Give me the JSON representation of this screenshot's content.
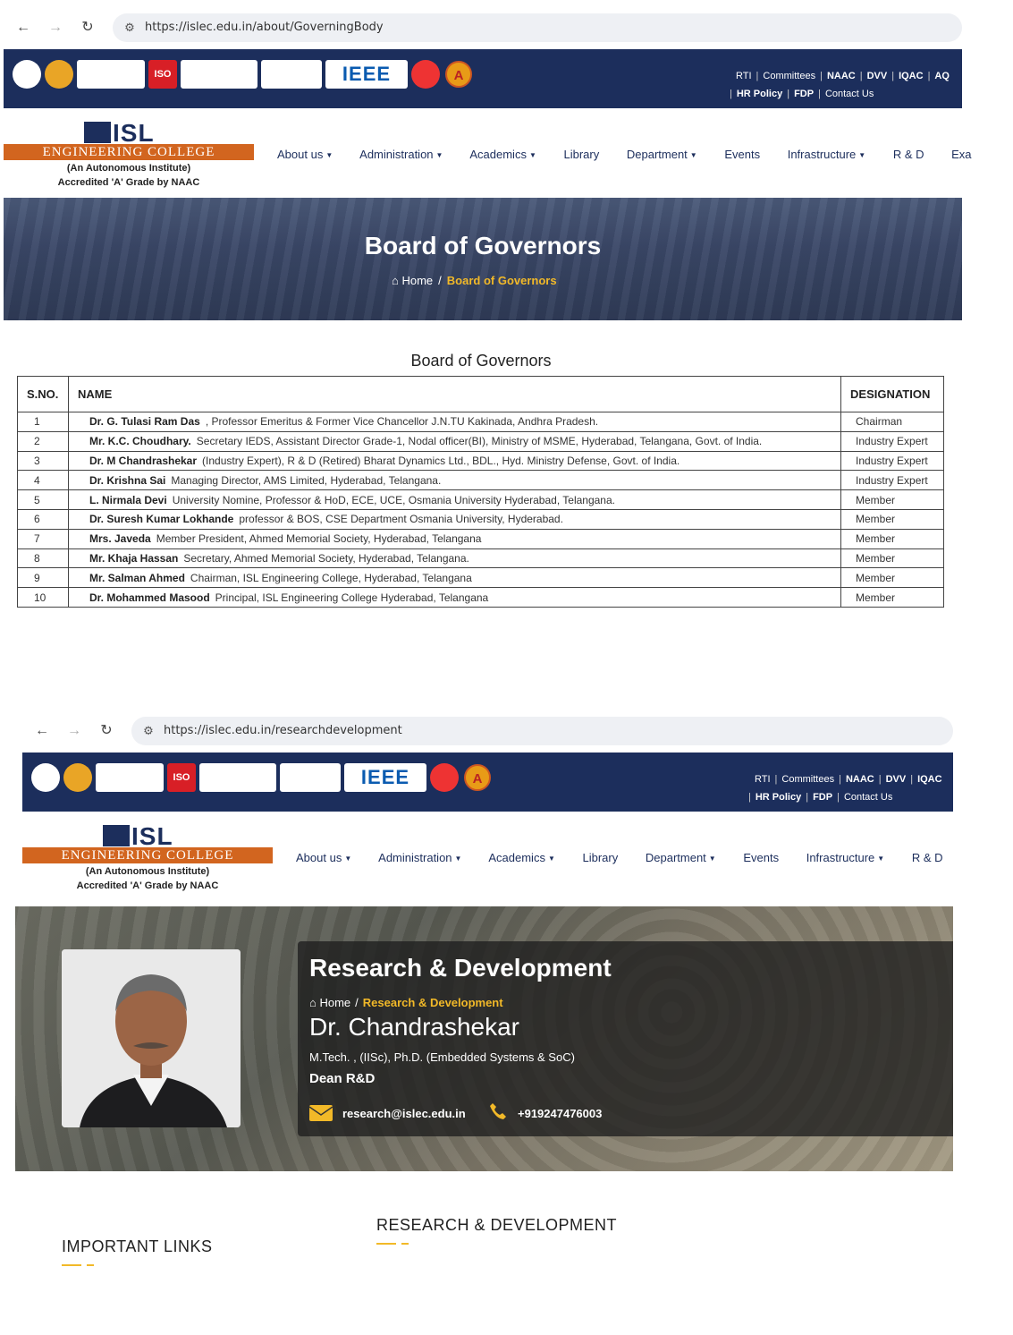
{
  "shot1": {
    "url": "https://islec.edu.in/about/GoverningBody",
    "breadcrumb": {
      "home": "Home",
      "current": "Board of Governors"
    },
    "banner_title": "Board of Governors",
    "table_title": "Board of Governors",
    "columns": {
      "sno": "S.NO.",
      "name": "NAME",
      "designation": "DESIGNATION"
    },
    "rows": [
      {
        "sno": "1",
        "name": "Dr. G. Tulasi Ram Das",
        "detail": ", Professor Emeritus & Former Vice Chancellor J.N.TU Kakinada, Andhra Pradesh.",
        "designation": "Chairman"
      },
      {
        "sno": "2",
        "name": "Mr. K.C. Choudhary.",
        "detail": "Secretary IEDS, Assistant Director Grade-1, Nodal officer(BI), Ministry of MSME, Hyderabad, Telangana, Govt. of India.",
        "designation": "Industry Expert"
      },
      {
        "sno": "3",
        "name": "Dr. M Chandrashekar",
        "detail": "(Industry Expert), R & D (Retired) Bharat Dynamics Ltd., BDL., Hyd. Ministry Defense, Govt. of India.",
        "designation": "Industry Expert"
      },
      {
        "sno": "4",
        "name": "Dr. Krishna Sai",
        "detail": "Managing Director, AMS Limited, Hyderabad, Telangana.",
        "designation": "Industry Expert"
      },
      {
        "sno": "5",
        "name": "L. Nirmala Devi",
        "detail": "University Nomine, Professor & HoD, ECE, UCE, Osmania University Hyderabad, Telangana.",
        "designation": "Member"
      },
      {
        "sno": "6",
        "name": "Dr. Suresh Kumar Lokhande",
        "detail": "professor & BOS, CSE Department Osmania University, Hyderabad.",
        "designation": "Member"
      },
      {
        "sno": "7",
        "name": "Mrs. Javeda",
        "detail": "Member President, Ahmed Memorial Society, Hyderabad, Telangana",
        "designation": "Member"
      },
      {
        "sno": "8",
        "name": "Mr. Khaja Hassan",
        "detail": "Secretary, Ahmed Memorial Society, Hyderabad, Telangana.",
        "designation": "Member"
      },
      {
        "sno": "9",
        "name": "Mr. Salman Ahmed",
        "detail": "Chairman, ISL Engineering College, Hyderabad, Telangana",
        "designation": "Member"
      },
      {
        "sno": "10",
        "name": "Dr. Mohammed Masood",
        "detail": "Principal, ISL Engineering College Hyderabad, Telangana",
        "designation": "Member"
      }
    ]
  },
  "shot2": {
    "url": "https://islec.edu.in/researchdevelopment",
    "banner_title": "Research & Development",
    "breadcrumb": {
      "home": "Home",
      "current": "Research & Development"
    },
    "person_name": "Dr. Chandrashekar",
    "qualification": "M.Tech. , (IISc), Ph.D. (Embedded Systems & SoC)",
    "role": "Dean R&D",
    "email": "research@islec.edu.in",
    "phone": "+919247476003",
    "important_links": "IMPORTANT LINKS",
    "rd_heading": "RESEARCH & DEVELOPMENT"
  },
  "site": {
    "college_short": "ISL",
    "college_band": "ENGINEERING COLLEGE",
    "college_sub1": "(An Autonomous Institute)",
    "college_sub2": "Accredited 'A' Grade by NAAC",
    "logos": [
      "IEEE",
      "ISO"
    ],
    "naac_logo": "A",
    "toplinks": [
      "RTI",
      "Committees",
      "NAAC",
      "DVV",
      "IQAC",
      "AQ"
    ],
    "toplinks_b": [
      "RTI",
      "Committees",
      "NAAC",
      "DVV",
      "IQAC"
    ],
    "toplinks2": [
      "HR Policy",
      "FDP",
      "Contact Us"
    ],
    "menu1": [
      "About us",
      "Administration",
      "Academics",
      "Library",
      "Department",
      "Events",
      "Infrastructure",
      "R & D",
      "Exa"
    ],
    "menu2": [
      "About us",
      "Administration",
      "Academics",
      "Library",
      "Department",
      "Events",
      "Infrastructure",
      "R & D"
    ]
  },
  "colors": {
    "navy": "#1c2e5c",
    "orange": "#d2651f",
    "gold": "#f2b928"
  }
}
